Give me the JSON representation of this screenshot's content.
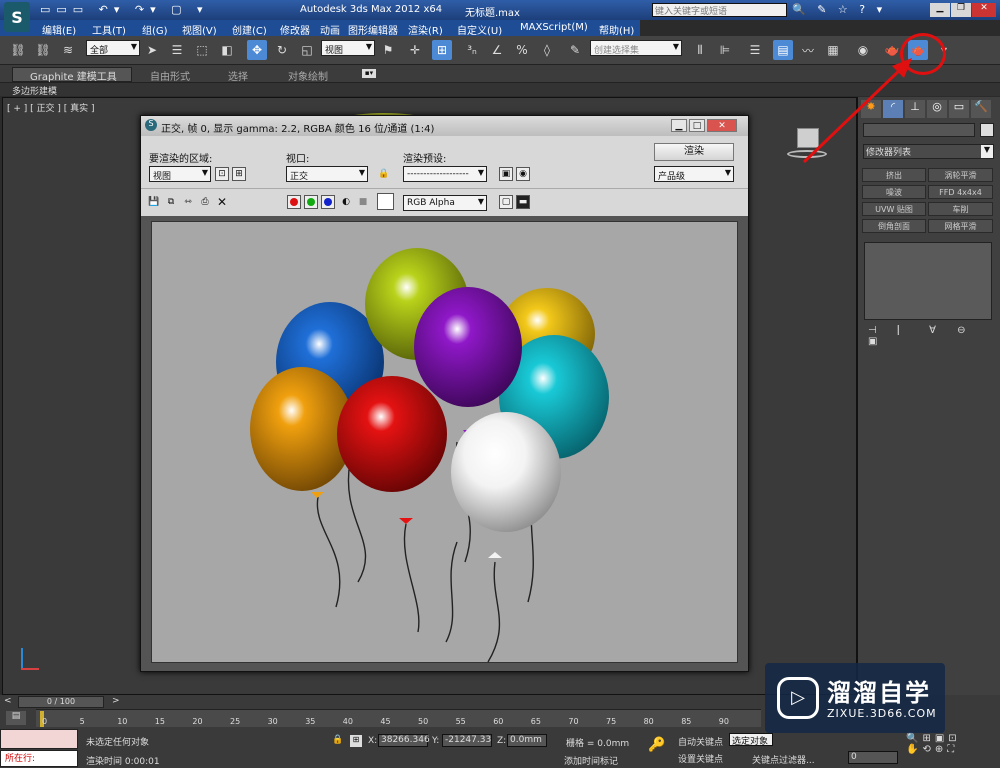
{
  "titlebar": {
    "app_title": "Autodesk 3ds Max  2012 x64",
    "file_name": "无标题.max",
    "search_placeholder": "键入关键字或短语"
  },
  "menu": [
    "编辑(E)",
    "工具(T)",
    "组(G)",
    "视图(V)",
    "创建(C)",
    "修改器",
    "动画",
    "图形编辑器",
    "渲染(R)",
    "自定义(U)",
    "MAXScript(M)",
    "帮助(H)"
  ],
  "toolbar": {
    "filter_value": "全部",
    "refcoord_value": "视图",
    "named_selection": "创建选择集"
  },
  "ribbon": {
    "tabs": [
      "Graphite 建模工具",
      "自由形式",
      "选择",
      "对象绘制"
    ],
    "sub_label": "多边形建模"
  },
  "viewport": {
    "label": "[ + ] [ 正交 ] [ 真实 ]"
  },
  "render_window": {
    "title": "正交, 帧 0, 显示 gamma: 2.2, RGBA 颜色 16 位/通道 (1:4)",
    "area_label": "要渲染的区域:",
    "area_value": "视图",
    "viewport_label": "视口:",
    "viewport_value": "正交",
    "preset_label": "渲染预设:",
    "preset_value": "-------------------",
    "render_button": "渲染",
    "quality_value": "产品级",
    "channel_value": "RGB Alpha"
  },
  "right_panel": {
    "modifier_list": "修改器列表",
    "buttons": [
      "挤出",
      "涡轮平滑",
      "噪波",
      "FFD 4x4x4",
      "UVW 贴图",
      "车削",
      "倒角剖面",
      "网格平滑"
    ]
  },
  "timeline": {
    "frame_counter": "0 / 100",
    "ticks": [
      "0",
      "5",
      "10",
      "15",
      "20",
      "25",
      "30",
      "35",
      "40",
      "45",
      "50",
      "55",
      "60",
      "65",
      "70",
      "75",
      "80",
      "85",
      "90"
    ],
    "status": "未选定任何对象",
    "render_time": "渲染时间  0:00:01",
    "x_value": "38266.346",
    "y_value": "-21247.33",
    "z_value": "0.0mm",
    "grid": "栅格 = 0.0mm",
    "auto_key": "自动关键点",
    "set_key": "设置关键点",
    "selected": "选定对象",
    "key_filters": "关键点过滤器...",
    "add_time_tag": "添加时间标记",
    "running": "所在行:",
    "frame_field": "0"
  },
  "watermark": {
    "brand": "溜溜自学",
    "url": "ZIXUE.3D66.COM"
  },
  "colors": {
    "annotation_red": "#e01010",
    "highlight_blue": "#4d8ad6"
  },
  "balloons": [
    {
      "name": "balloon-blue",
      "color": "#1f6fd8"
    },
    {
      "name": "balloon-yellow-green",
      "color": "#b9d21a"
    },
    {
      "name": "balloon-yellow",
      "color": "#f2c81a"
    },
    {
      "name": "balloon-purple",
      "color": "#8f18c8"
    },
    {
      "name": "balloon-cyan",
      "color": "#19c9d6"
    },
    {
      "name": "balloon-orange",
      "color": "#f0a00e"
    },
    {
      "name": "balloon-red",
      "color": "#e41212"
    },
    {
      "name": "balloon-white",
      "color": "#f3f3f3"
    }
  ]
}
